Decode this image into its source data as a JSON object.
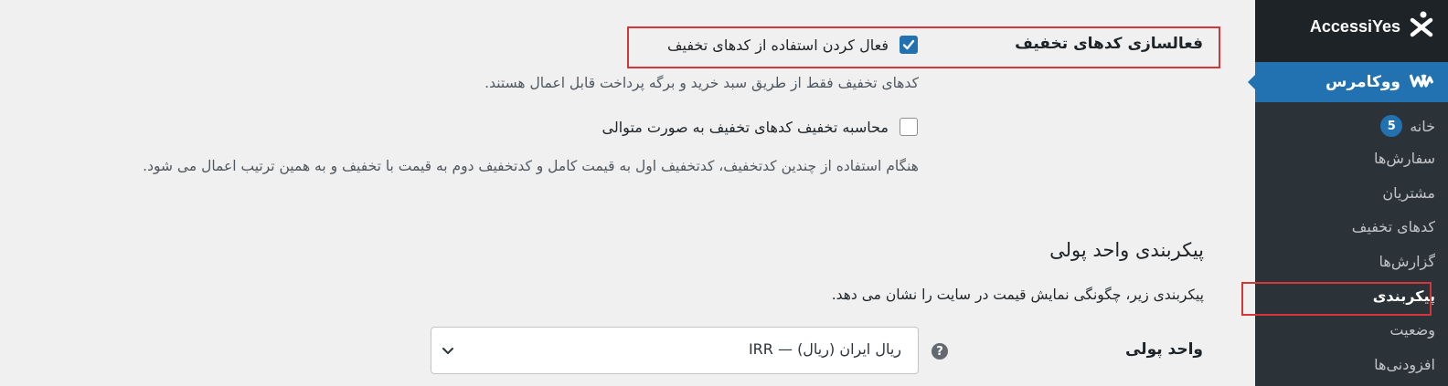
{
  "sidebar": {
    "brand": "AccessiYes",
    "woocommerce_label": "ووکامرس",
    "items": [
      {
        "label": "خانه",
        "badge": "5"
      },
      {
        "label": "سفارش‌ها"
      },
      {
        "label": "مشتریان"
      },
      {
        "label": "کدهای تخفیف"
      },
      {
        "label": "گزارش‌ها"
      },
      {
        "label": "پیکربندی",
        "active": true
      },
      {
        "label": "وضعیت"
      },
      {
        "label": "افزودنی‌ها"
      }
    ]
  },
  "coupons": {
    "title": "فعالسازی کدهای تخفیف",
    "enable_label": "فعال کردن استفاده از کدهای تخفیف",
    "enable_checked": true,
    "enable_desc": "کدهای تخفیف فقط از طریق سبد خرید و برگه پرداخت قابل اعمال هستند.",
    "sequential_label": "محاسبه تخفیف کدهای تخفیف به صورت متوالی",
    "sequential_checked": false,
    "sequential_desc": "هنگام استفاده از چندین کدتخفیف، کدتخفیف اول به قیمت کامل و کدتخفیف دوم به قیمت با تخفیف و به همین ترتیب اعمال می شود."
  },
  "currency": {
    "heading": "پیکربندی واحد پولی",
    "desc": "پیکربندی زیر، چگونگی نمایش قیمت در سایت را نشان می دهد.",
    "field_label": "واحد پولی",
    "help_glyph": "?",
    "selected": "ریال ایران (ریال) — IRR"
  },
  "colors": {
    "sidebar_bg": "#1d2327",
    "accent": "#2271b1",
    "highlight": "#d63638"
  },
  "icons": [
    "accessiyes-logo-icon",
    "woo-icon",
    "check-icon",
    "help-icon",
    "chevron-down-icon"
  ]
}
